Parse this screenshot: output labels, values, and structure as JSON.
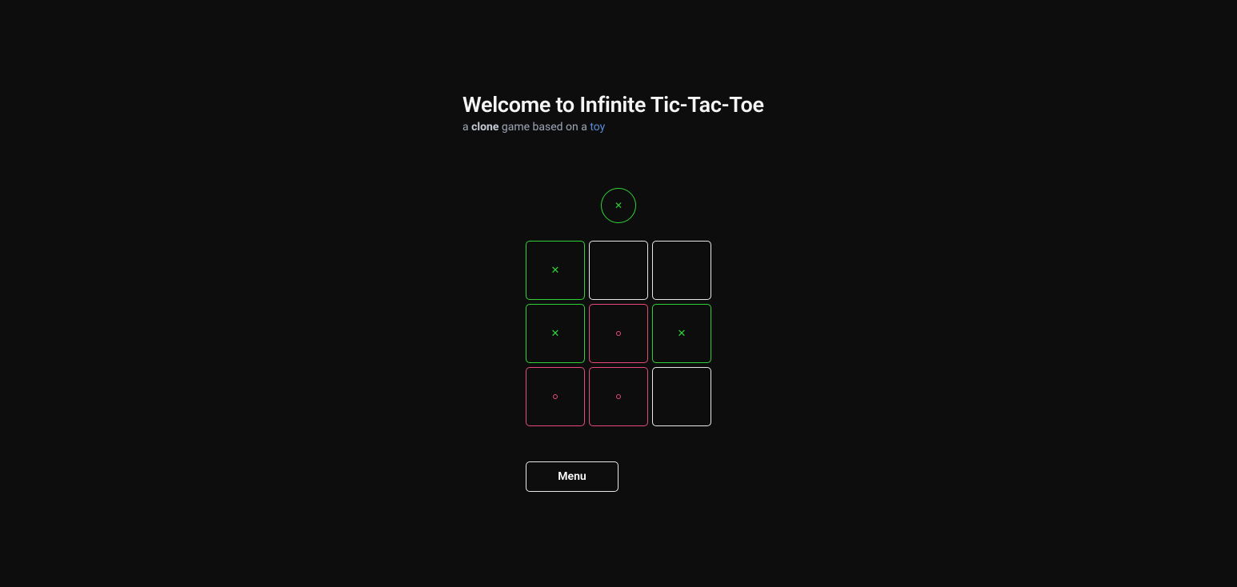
{
  "header": {
    "title": "Welcome to Infinite Tic-Tac-Toe",
    "subtitle_prefix": "a ",
    "subtitle_bold": "clone",
    "subtitle_mid": " game based on a ",
    "subtitle_link": "toy"
  },
  "turn": {
    "current": "x"
  },
  "board": {
    "cells": [
      {
        "mark": "x"
      },
      {
        "mark": ""
      },
      {
        "mark": ""
      },
      {
        "mark": "x"
      },
      {
        "mark": "o"
      },
      {
        "mark": "x"
      },
      {
        "mark": "o"
      },
      {
        "mark": "o"
      },
      {
        "mark": ""
      }
    ]
  },
  "buttons": {
    "menu": "Menu"
  },
  "colors": {
    "x": "#2fd137",
    "o": "#e84a7a",
    "bg": "#0d0d0d",
    "text": "#ffffff",
    "muted": "#a0a7b8",
    "link": "#5b8dd6",
    "border": "#e8e8e8"
  }
}
